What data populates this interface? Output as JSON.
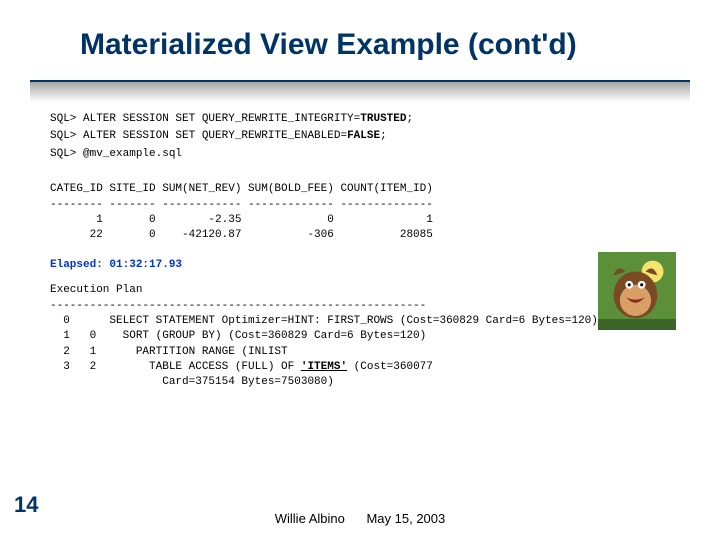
{
  "title": "Materialized View Example (cont'd)",
  "sql": {
    "line1_prefix": "SQL> ALTER SESSION SET QUERY_REWRITE_INTEGRITY=",
    "line1_bold": "TRUSTED",
    "line1_suffix": ";",
    "line2_prefix": "SQL> ALTER SESSION SET QUERY_REWRITE_ENABLED=",
    "line2_bold": "FALSE",
    "line2_suffix": ";",
    "line3": "SQL> @mv_example.sql"
  },
  "table": {
    "header": "CATEG_ID SITE_ID SUM(NET_REV) SUM(BOLD_FEE) COUNT(ITEM_ID)",
    "sep": "-------- ------- ------------ ------------- --------------",
    "row1": "       1       0        -2.35             0              1",
    "row2": "      22       0    -42120.87          -306          28085"
  },
  "elapsed_label": "Elapsed: ",
  "elapsed_value": "01:32:17.93",
  "plan": {
    "header": "Execution Plan",
    "sep": "---------------------------------------------------------",
    "l0": "  0      SELECT STATEMENT Optimizer=HINT: FIRST_ROWS (Cost=360829 Card=6 Bytes=120)",
    "l1": "  1   0    SORT (GROUP BY) (Cost=360829 Card=6 Bytes=120)",
    "l2": "  2   1      PARTITION RANGE (INLIST",
    "l3_prefix": "  3   2        TABLE ACCESS (FULL) OF ",
    "l3_bold": "'ITEMS'",
    "l3_suffix": " (Cost=360077",
    "l4": "                 Card=375154 Bytes=7503080)"
  },
  "page_number": "14",
  "footer_author": "Willie Albino",
  "footer_date": "May 15, 2003"
}
